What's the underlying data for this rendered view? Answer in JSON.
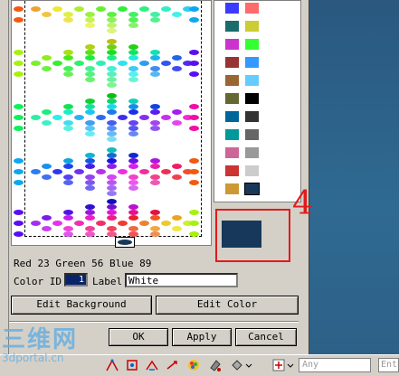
{
  "dialog": {
    "rgb_text": "Red 23 Green 56 Blue 89",
    "color_id_label": "Color ID",
    "color_id_value": "1",
    "label_label": "Label",
    "label_value": "White",
    "edit_background_label": "Edit Background",
    "edit_color_label": "Edit Color",
    "ok_label": "OK",
    "apply_label": "Apply",
    "cancel_label": "Cancel",
    "annotation_number": "4",
    "selected_color": "#17385a"
  },
  "swatches": [
    [
      "#3b3bff",
      "#ff6b6b"
    ],
    [
      "#1a6b6b",
      "#cccc33"
    ],
    [
      "#cc33cc",
      "#33ff33"
    ],
    [
      "#993333",
      "#3399ff"
    ],
    [
      "#996633",
      "#66ccff"
    ],
    [
      "#666633",
      "#000000"
    ],
    [
      "#006699",
      "#333333"
    ],
    [
      "#009999",
      "#666666"
    ],
    [
      "#cc6699",
      "#999999"
    ],
    [
      "#cc3333",
      "#cccccc"
    ],
    [
      "#cc9933",
      "#17385a"
    ]
  ],
  "taskbar": {
    "any_text": "Any",
    "ent_text": "Ent"
  },
  "watermark": {
    "chinese": "三维网",
    "url": "3dportal.cn"
  }
}
